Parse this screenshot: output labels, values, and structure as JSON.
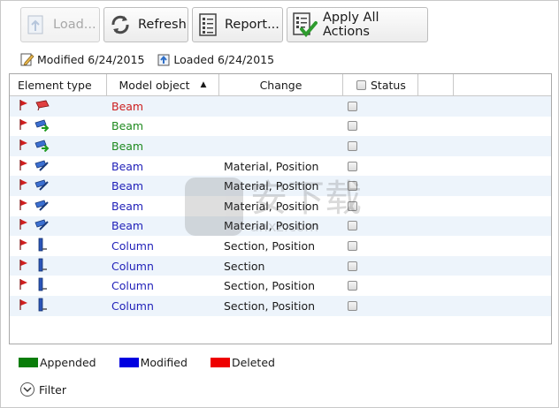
{
  "toolbar": {
    "load_label": "Load...",
    "refresh_label": "Refresh",
    "report_label": "Report...",
    "apply_label": "Apply All Actions"
  },
  "info": {
    "modified": "Modified 6/24/2015",
    "loaded": "Loaded 6/24/2015"
  },
  "table": {
    "headers": {
      "element_type": "Element type",
      "model_object": "Model object",
      "change": "Change",
      "status": "Status"
    },
    "sort": {
      "column": "model_object",
      "direction": "ascending"
    },
    "rows": [
      {
        "element_icon": "beam-deleted-icon",
        "object": "Beam",
        "object_color": "#cc1f1f",
        "change": ""
      },
      {
        "element_icon": "beam-appended-icon",
        "object": "Beam",
        "object_color": "#1f8a1f",
        "change": ""
      },
      {
        "element_icon": "beam-appended-icon",
        "object": "Beam",
        "object_color": "#1f8a1f",
        "change": ""
      },
      {
        "element_icon": "beam-modified-icon",
        "object": "Beam",
        "object_color": "#1f1fb8",
        "change": "Material, Position"
      },
      {
        "element_icon": "beam-modified-icon",
        "object": "Beam",
        "object_color": "#1f1fb8",
        "change": "Material, Position"
      },
      {
        "element_icon": "beam-modified-icon",
        "object": "Beam",
        "object_color": "#1f1fb8",
        "change": "Material, Position"
      },
      {
        "element_icon": "beam-modified-icon",
        "object": "Beam",
        "object_color": "#1f1fb8",
        "change": "Material, Position"
      },
      {
        "element_icon": "column-modified-icon",
        "object": "Column",
        "object_color": "#1f1fb8",
        "change": "Section, Position"
      },
      {
        "element_icon": "column-modified-icon",
        "object": "Column",
        "object_color": "#1f1fb8",
        "change": "Section"
      },
      {
        "element_icon": "column-modified-icon",
        "object": "Column",
        "object_color": "#1f1fb8",
        "change": "Section, Position"
      },
      {
        "element_icon": "column-modified-icon",
        "object": "Column",
        "object_color": "#1f1fb8",
        "change": "Section, Position"
      }
    ]
  },
  "legend": [
    {
      "label": "Appended",
      "color": "#0a7d0a"
    },
    {
      "label": "Modified",
      "color": "#0000e0"
    },
    {
      "label": "Deleted",
      "color": "#ee0000"
    }
  ],
  "filter_label": "Filter",
  "watermark": {
    "text": "安下载",
    "subtext": "anxz.com"
  }
}
